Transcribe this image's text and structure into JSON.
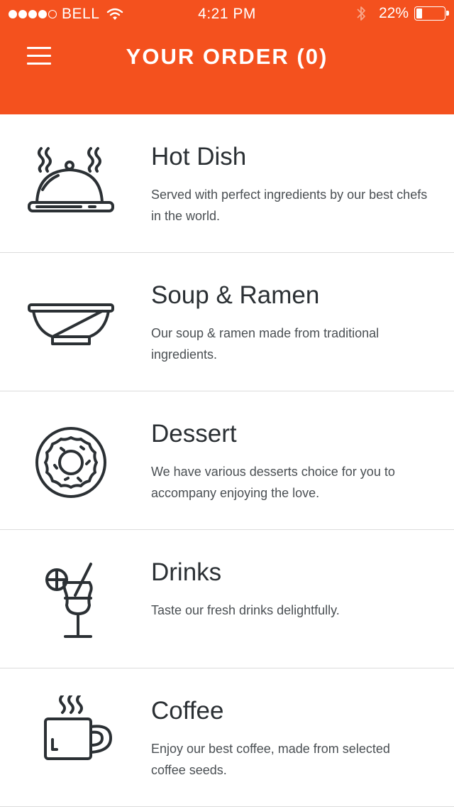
{
  "status_bar": {
    "carrier": "BELL",
    "time": "4:21 PM",
    "battery": "22%",
    "battery_level": 0.22
  },
  "header": {
    "title": "YOUR ORDER (0)",
    "menu_icon": "hamburger-menu-icon",
    "background_color": "#f4511e"
  },
  "categories": [
    {
      "title": "Hot Dish",
      "description": "Served with perfect ingredients by our best chefs in the world.",
      "icon": "cloche-icon"
    },
    {
      "title": "Soup & Ramen",
      "description": "Our soup & ramen made from traditional ingredients.",
      "icon": "bowl-icon"
    },
    {
      "title": "Dessert",
      "description": "We have various desserts choice for you to accompany enjoying the love.",
      "icon": "donut-icon"
    },
    {
      "title": "Drinks",
      "description": "Taste our fresh drinks delightfully.",
      "icon": "cocktail-icon"
    },
    {
      "title": "Coffee",
      "description": "Enjoy our best coffee, made from selected coffee seeds.",
      "icon": "coffee-cup-icon"
    }
  ]
}
